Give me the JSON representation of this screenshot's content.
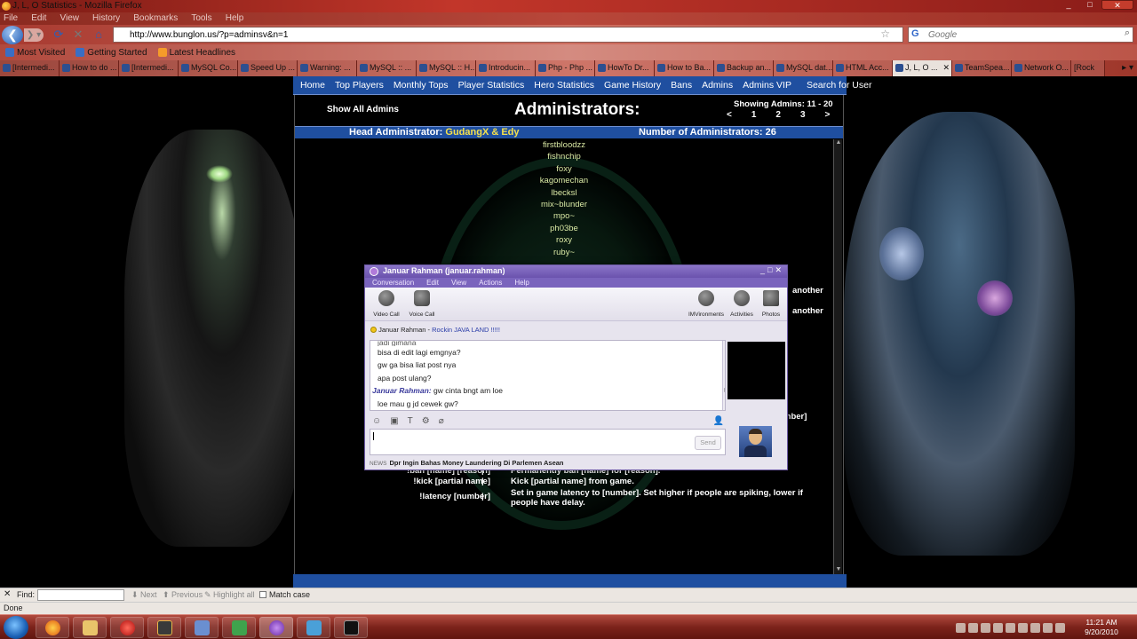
{
  "window": {
    "title": "J, L, O Statistics - Mozilla Firefox"
  },
  "menubar": [
    "File",
    "Edit",
    "View",
    "History",
    "Bookmarks",
    "Tools",
    "Help"
  ],
  "navigation": {
    "url": "http://www.bunglon.us/?p=adminsv&n=1",
    "search_placeholder": "Google"
  },
  "bookmarks": [
    "Most Visited",
    "Getting Started",
    "Latest Headlines"
  ],
  "tabs": [
    {
      "label": "[Intermedi..."
    },
    {
      "label": "How to do ..."
    },
    {
      "label": "[Intermedi..."
    },
    {
      "label": "MySQL Co..."
    },
    {
      "label": "Speed Up ..."
    },
    {
      "label": "Warning: ..."
    },
    {
      "label": "MySQL :: ..."
    },
    {
      "label": "MySQL :: H..."
    },
    {
      "label": "Introducin..."
    },
    {
      "label": "Php - Php ..."
    },
    {
      "label": "HowTo Dr..."
    },
    {
      "label": "How to Ba..."
    },
    {
      "label": "Backup an..."
    },
    {
      "label": "MySQL dat..."
    },
    {
      "label": "HTML Acc..."
    },
    {
      "label": "J, L, O ...",
      "active": true
    },
    {
      "label": "TeamSpea..."
    },
    {
      "label": "Network O..."
    },
    {
      "label": "[Rock"
    }
  ],
  "site": {
    "nav": [
      "Home",
      "Top Players",
      "Monthly Tops",
      "Player Statistics",
      "Hero Statistics",
      "Game History",
      "Bans",
      "Admins",
      "Admins VIP",
      "Search for User"
    ],
    "show_all": "Show All Admins",
    "heading": "Administrators:",
    "showing": "Showing Admins: 11 - 20",
    "pager": [
      "<",
      "1",
      "2",
      "3",
      ">"
    ],
    "head_admin_label": "Head Administrator:",
    "head_admin_names": "GudangX & Edy",
    "admin_count": "Number of Administrators: 26",
    "admins": [
      "firstbloodzz",
      "fishnchip",
      "foxy",
      "kagomechan",
      "lbecksl",
      "mix~blunder",
      "mpo~",
      "ph03be",
      "roxy",
      "ruby~"
    ],
    "edge_texts": [
      "another",
      "another",
      "mber]"
    ],
    "commands": [
      {
        "cmd": "!ban [name] [reason]",
        "sep": "|",
        "desc": "Permanently ban [name] for [reason]."
      },
      {
        "cmd": "!kick [partial name]",
        "sep": "|",
        "desc": "Kick [partial name] from game."
      },
      {
        "cmd": "!latency [number]",
        "sep": "|",
        "desc": "Set in game latency to [number]. Set higher if people are spiking, lower if people have delay."
      }
    ]
  },
  "messenger": {
    "title": "Januar Rahman (januar.rahman)",
    "menu": [
      "Conversation",
      "Edit",
      "View",
      "Actions",
      "Help"
    ],
    "toolbar": [
      "Video Call",
      "Voice Call",
      "IMVironments",
      "Activities",
      "Photos"
    ],
    "status_name": "Januar Rahman",
    "status_msg": "Rockin JAVA LAND !!!!!",
    "messages": [
      {
        "text": "jadi gimana",
        "cut": true
      },
      {
        "text": "bisa di edit lagi emgnya?"
      },
      {
        "text": "gw ga bisa liat post nya"
      },
      {
        "text": "apa post ulang?"
      },
      {
        "sender": "Januar Rahman:",
        "text": "gw cinta bngt am loe"
      },
      {
        "text": "loe mau g jd cewek gw?"
      }
    ],
    "send_label": "Send",
    "news_tag": "NEWS",
    "news_text": "Dpr Ingin Bahas Money Laundering Di Parlemen Asean"
  },
  "findbar": {
    "label": "Find:",
    "next": "Next",
    "previous": "Previous",
    "highlight": "Highlight all",
    "match_case": "Match case"
  },
  "statusbar": {
    "text": "Done"
  },
  "clock": {
    "time": "11:21 AM",
    "date": "9/20/2010"
  }
}
